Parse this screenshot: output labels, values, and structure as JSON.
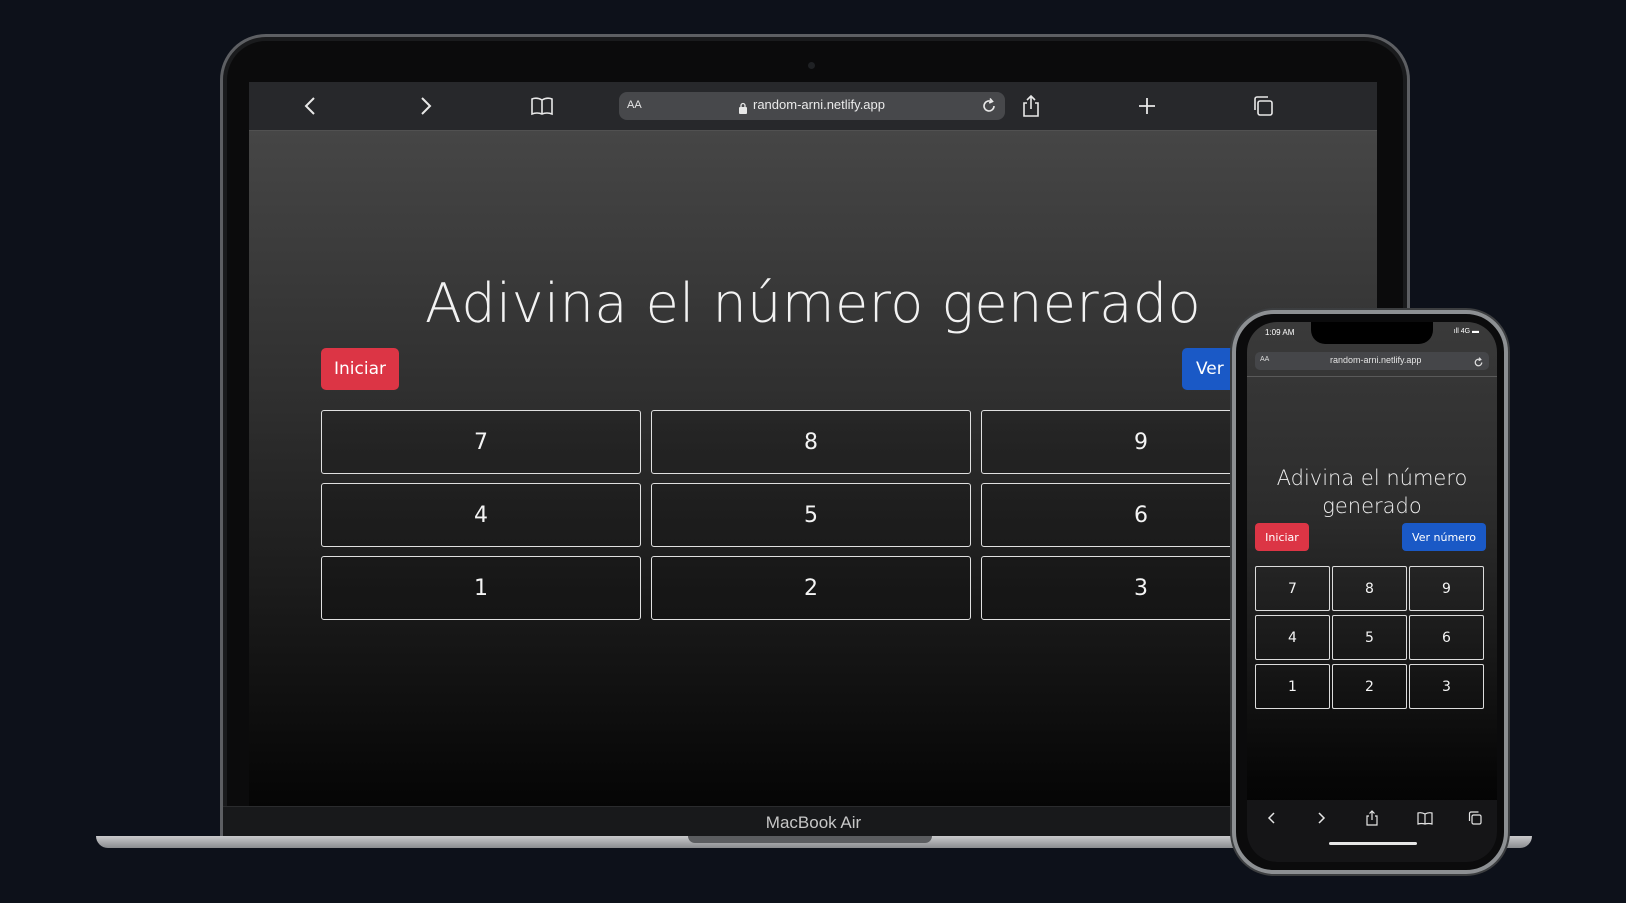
{
  "laptop": {
    "model_label": "MacBook Air",
    "browser": {
      "reader_label": "AA",
      "url": "random-arni.netlify.app",
      "icons": [
        "chevron-left-icon",
        "chevron-right-icon",
        "book-icon",
        "lock-icon",
        "reload-icon",
        "share-icon",
        "plus-icon",
        "tabs-icon"
      ]
    },
    "page": {
      "title": "Adivina el número generado",
      "start_button": "Iniciar",
      "view_button": "Ver r",
      "keypad": [
        "7",
        "8",
        "9",
        "4",
        "5",
        "6",
        "1",
        "2",
        "3"
      ]
    }
  },
  "phone": {
    "time": "1:09 AM",
    "status": "ıll 4G ▬",
    "browser": {
      "reader_label": "AA",
      "url": "random-arni.netlify.app"
    },
    "page": {
      "title": "Adivina el número generado",
      "start_button": "Iniciar",
      "view_button": "Ver número",
      "keypad": [
        "7",
        "8",
        "9",
        "4",
        "5",
        "6",
        "1",
        "2",
        "3"
      ]
    },
    "tabbar_icons": [
      "back-icon",
      "forward-icon",
      "share-icon",
      "bookmarks-icon",
      "tabs-icon"
    ]
  },
  "colors": {
    "start": "#dc3545",
    "view": "#1a59c6",
    "background": "#0d111a"
  }
}
